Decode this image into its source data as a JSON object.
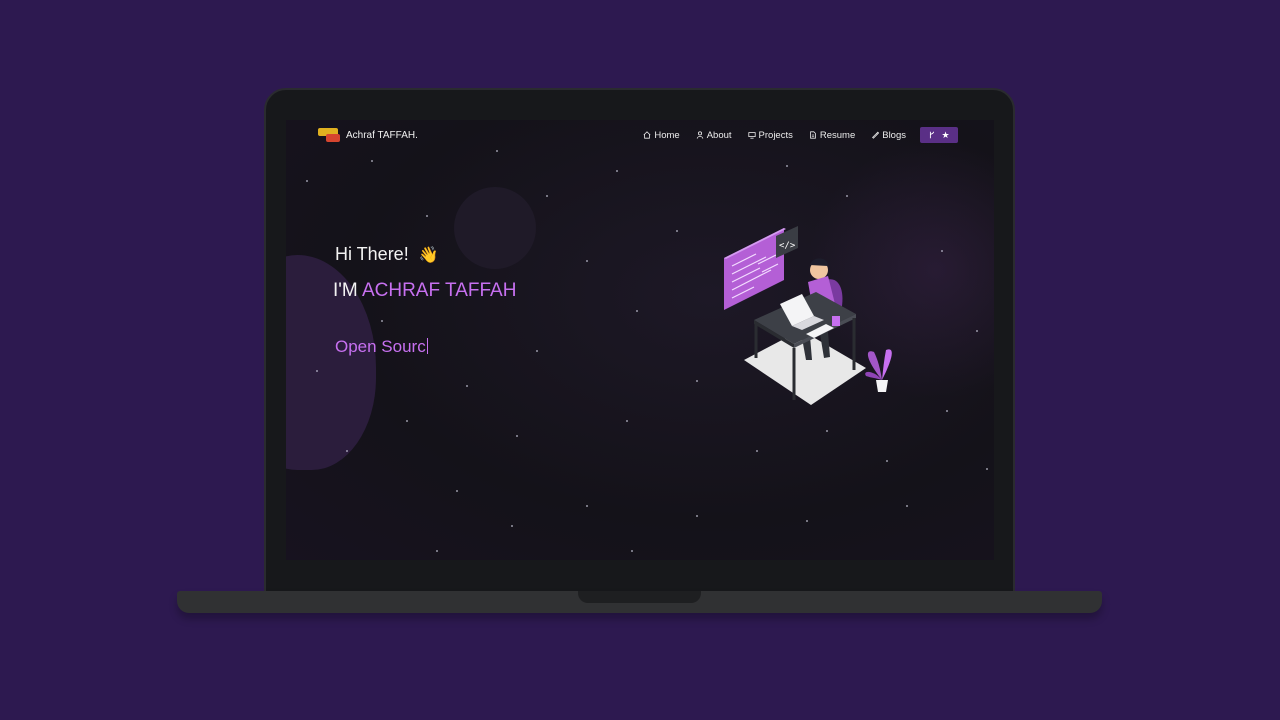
{
  "navbar": {
    "brand": "Achraf TAFFAH.",
    "items": [
      {
        "label": "Home",
        "icon": "home-icon"
      },
      {
        "label": "About",
        "icon": "user-icon"
      },
      {
        "label": "Projects",
        "icon": "projects-icon"
      },
      {
        "label": "Resume",
        "icon": "document-icon"
      },
      {
        "label": "Blogs",
        "icon": "blog-icon"
      }
    ],
    "fork_icons": [
      "fork-icon",
      "star-icon"
    ]
  },
  "hero": {
    "greeting": "Hi There!",
    "wave": "👋",
    "prefix": "I'M",
    "name": "ACHRAF TAFFAH",
    "typed": "Open Sourc"
  },
  "colors": {
    "accent": "#c770f0",
    "background": "#2d1950",
    "screen": "#141219"
  }
}
